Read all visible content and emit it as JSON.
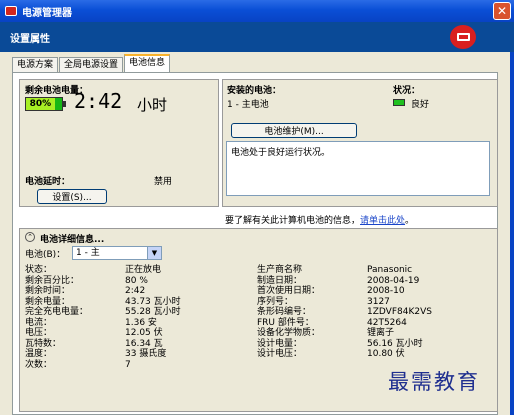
{
  "window": {
    "title": "电源管理器"
  },
  "header": {
    "title": "设置属性"
  },
  "tabs": [
    {
      "label": "电源方案"
    },
    {
      "label": "全局电源设置"
    },
    {
      "label": "电池信息"
    }
  ],
  "charge": {
    "label": "剩余电池电量：",
    "percent_text": "80%",
    "percent_value": 80,
    "time": "2:42",
    "time_unit": "小时"
  },
  "delay": {
    "label": "电池延时：",
    "value": "禁用",
    "settings_button": "设置(S)..."
  },
  "installed": {
    "label": "安装的电池：",
    "item": "1 - 主电池",
    "status_label": "状况：",
    "status_value": "良好"
  },
  "maintenance": {
    "button": "电池维护(M)..."
  },
  "message": {
    "text": "电池处于良好运行状况。"
  },
  "info_line": {
    "text": "要了解有关此计算机电池的信息，",
    "link": "请单击此处",
    "end": "。"
  },
  "details": {
    "title": "电池详细信息...",
    "battery_label": "电池(B)：",
    "battery_selected": "1 - 主",
    "left": [
      {
        "k": "状态：",
        "v": "正在放电"
      },
      {
        "k": "剩余百分比：",
        "v": "80 %"
      },
      {
        "k": "剩余时间：",
        "v": "2:42"
      },
      {
        "k": "剩余电量：",
        "v": "43.73 瓦小时"
      },
      {
        "k": "完全充电电量：",
        "v": "55.28 瓦小时"
      },
      {
        "k": "电流：",
        "v": "1.36 安"
      },
      {
        "k": "电压：",
        "v": "12.05 伏"
      },
      {
        "k": "瓦特数：",
        "v": "16.34 瓦"
      },
      {
        "k": "温度：",
        "v": "33 摄氏度"
      },
      {
        "k": "次数：",
        "v": "7"
      }
    ],
    "right": [
      {
        "k": "生产商名称",
        "v": "Panasonic"
      },
      {
        "k": "制造日期：",
        "v": "2008-04-19"
      },
      {
        "k": "首次使用日期：",
        "v": "2008-10"
      },
      {
        "k": "序列号：",
        "v": "3127"
      },
      {
        "k": "条形码编号：",
        "v": "1ZDVF84K2VS"
      },
      {
        "k": "FRU 部件号：",
        "v": "42T5264"
      },
      {
        "k": "设备化学物质：",
        "v": "锂离子"
      },
      {
        "k": "设计电量：",
        "v": "56.16 瓦小时"
      },
      {
        "k": "设计电压：",
        "v": "10.80 伏"
      }
    ]
  },
  "watermark": {
    "text": "最需教育"
  },
  "colors": {
    "titlebar": "#0a4fd6",
    "header": "#0a4a97",
    "panel": "#ece9d8",
    "battery_fill": "#a7ef24",
    "link": "#1a45c9"
  }
}
